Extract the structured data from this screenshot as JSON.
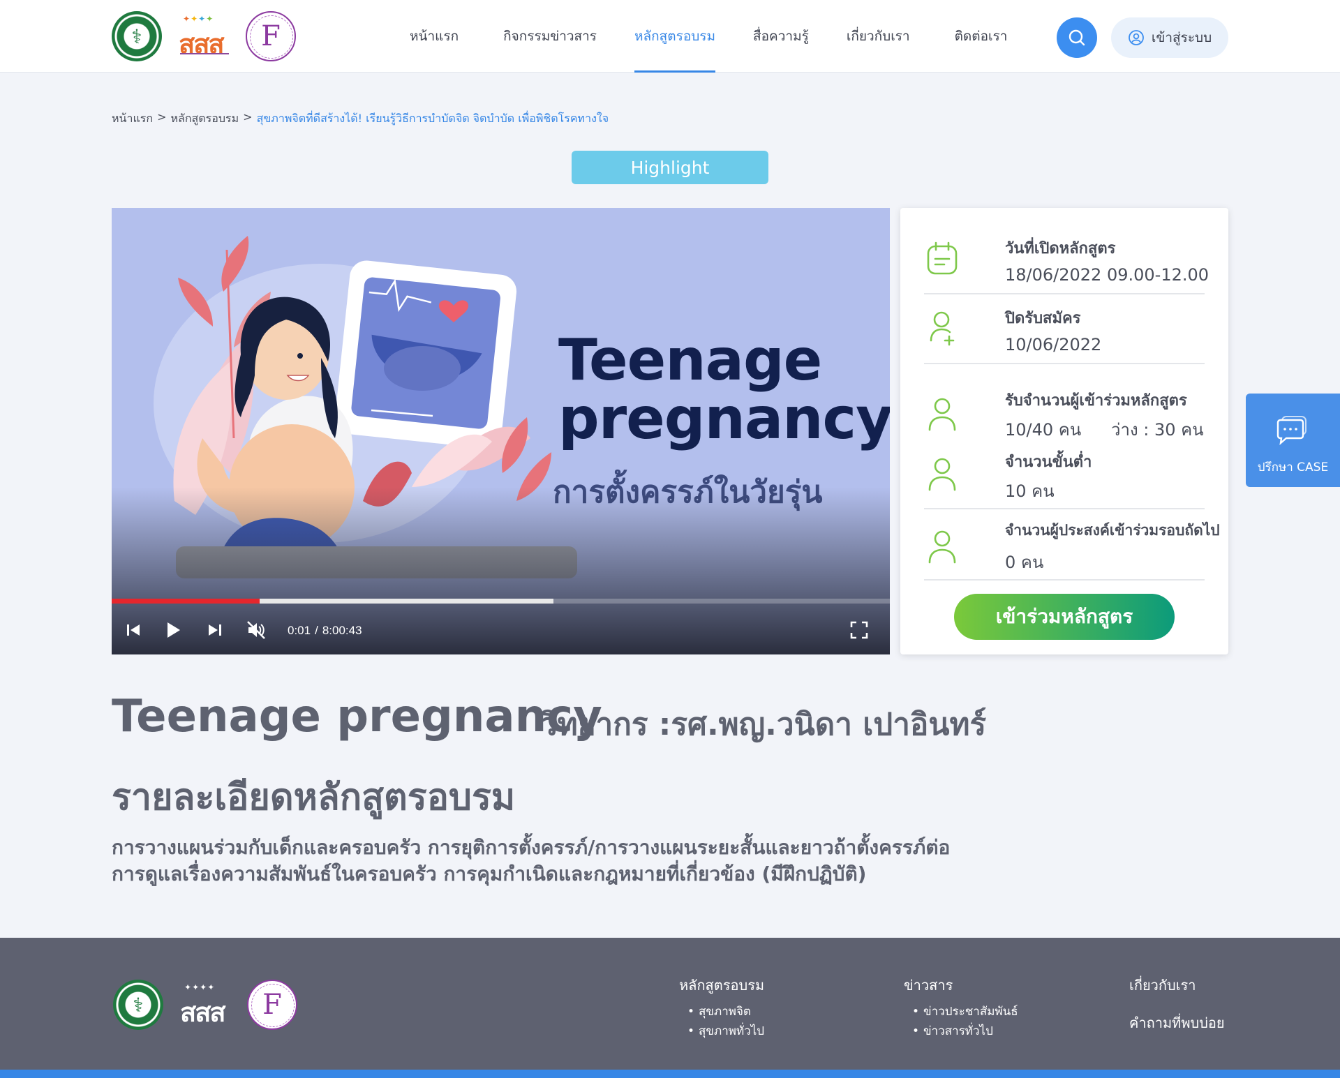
{
  "header": {
    "nav": [
      {
        "label": "หน้าแรก",
        "active": false
      },
      {
        "label": "กิจกรรมข่าวสาร",
        "active": false
      },
      {
        "label": "หลักสูตรอบรม",
        "active": true
      },
      {
        "label": "สื่อความรู้",
        "active": false
      },
      {
        "label": "เกี่ยวกับเรา",
        "active": false
      },
      {
        "label": "ติดต่อเรา",
        "active": false
      }
    ],
    "search_icon": "search-icon",
    "login_label": "เข้าสู่ระบบ",
    "logo_sss_text": "สสส"
  },
  "breadcrumb": {
    "home": "หน้าแรก",
    "sep": ">",
    "section": "หลักสูตรอบรม",
    "current": "สุขภาพจิตที่ดีสร้างได้! เรียนรู้วิธีการบำบัดจิต จิตบำบัด เพื่อพิชิตโรคทางใจ"
  },
  "badge": "Highlight",
  "video": {
    "title_line1": "Teenage",
    "title_line2": "pregnancy",
    "subtitle": "การตั้งครรภ์ในวัยรุ่น",
    "current_time": "0:01",
    "time_sep": "/",
    "duration": "8:00:43",
    "played_fraction": 0.19,
    "buffered_fraction": 0.568
  },
  "info": {
    "open_date_label": "วันที่เปิดหลักสูตร",
    "open_date_value": "18/06/2022  09.00-12.00",
    "close_label": "ปิดรับสมัคร",
    "close_value": "10/06/2022",
    "capacity_label": "รับจำนวนผู้เข้าร่วมหลักสูตร",
    "capacity_value": "10/40 คน",
    "available_value": "ว่าง : 30 คน",
    "minimum_label": "จำนวนขั้นต่ำ",
    "minimum_value": "10 คน",
    "waitlist_label": "จำนวนผู้ประสงค์เข้าร่วมรอบถัดไป",
    "waitlist_value": "0 คน",
    "join_label": "เข้าร่วมหลักสูตร"
  },
  "consult": {
    "label": "ปรึกษา CASE"
  },
  "course": {
    "title": "Teenage pregnancy",
    "speaker": "วิทยากร :รศ.พญ.วนิดา เปาอินทร์",
    "details_heading": "รายละเอียดหลักสูตรอบรม",
    "details_line1": "การวางแผนร่วมกับเด็กและครอบครัว การยุติการตั้งครรภ์/การวางแผนระยะสั้นและยาวถ้าตั้งครรภ์ต่อ",
    "details_line2": "การดูแลเรื่องความสัมพันธ์ในครอบครัว การคุมกำเนิดและกฎหมายที่เกี่ยวข้อง (มีฝึกปฏิบัติ)"
  },
  "footer": {
    "col1": {
      "heading": "หลักสูตรอบรม",
      "items": [
        "สุขภาพจิต",
        "สุขภาพทั่วไป"
      ]
    },
    "col2": {
      "heading": "ข่าวสาร",
      "items": [
        "ข่าวประชาสัมพันธ์",
        "ข่าวสารทั่วไป"
      ]
    },
    "col3": {
      "heading": "เกี่ยวกับเรา",
      "link": "คำถามที่พบบ่อย"
    }
  },
  "colors": {
    "accent": "#3787e6",
    "highlight": "#6ccbea",
    "join_start": "#7bc93a",
    "join_end": "#0c9b7b",
    "icon_green": "#7ec84a",
    "footer": "#5e6170"
  }
}
